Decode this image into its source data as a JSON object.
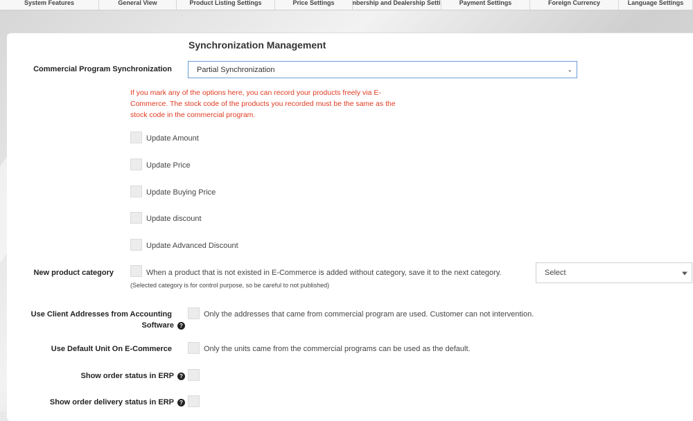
{
  "tabs": [
    "System Features",
    "General View",
    "Product Listing Settings",
    "Price Settings",
    "Membership and Dealership Settings",
    "Payment Settings",
    "Foreign Currency",
    "Language Settings"
  ],
  "section_title": "Synchronization Management",
  "sync": {
    "label": "Commercial Program Synchronization",
    "selected": "Partial Synchronization"
  },
  "warning": {
    "line1": "If you mark any of the options here, you can record your products freely via E-",
    "line2": "Commerce. The stock code of the products you recorded must be the same as the",
    "line3": "stock code in the commercial program."
  },
  "options": [
    "Update Amount",
    "Update Price",
    "Update Buying Price",
    "Update discount",
    "Update Advanced Discount"
  ],
  "new_category": {
    "label": "New product category",
    "text": "When a product that is not existed in E-Commerce is added without category, save it to the next category.",
    "note": "(Selected category is for control purpose, so be careful to not published)",
    "select": "Select"
  },
  "client_addresses": {
    "label_line1": "Use Client Addresses from Accounting",
    "label_line2": "Software",
    "text": "Only the addresses that came from commercial program are used. Customer can not intervention."
  },
  "default_unit": {
    "label": "Use Default Unit On E-Commerce",
    "text": "Only the units came from the commercial programs can be used as the default."
  },
  "order_status": {
    "label": "Show order status in ERP"
  },
  "delivery_status": {
    "label": "Show order delivery status in ERP"
  },
  "icons": {
    "help": "question-circle-icon",
    "dropdown": "chevron-down-icon"
  },
  "colors": {
    "warning": "#e03a20",
    "focus_border": "#6b9ad8"
  }
}
